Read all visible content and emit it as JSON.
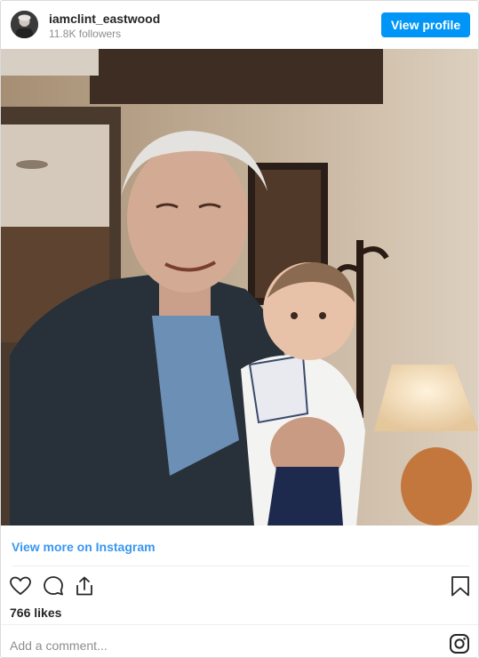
{
  "header": {
    "username": "iamclint_eastwood",
    "followers": "11.8K followers",
    "view_profile_label": "View profile",
    "avatar_icon": "profile-avatar"
  },
  "post": {
    "image_description": "",
    "view_more_label": "View more on Instagram",
    "likes": "766 likes",
    "comment_placeholder": "Add a comment..."
  },
  "icons": {
    "like": "heart-icon",
    "comment": "comment-bubble-icon",
    "share": "share-icon",
    "save": "bookmark-icon",
    "logo": "instagram-logo-icon"
  },
  "colors": {
    "accent": "#0095f6",
    "link": "#3897f0",
    "text": "#262626",
    "muted": "#8e8e8e"
  }
}
